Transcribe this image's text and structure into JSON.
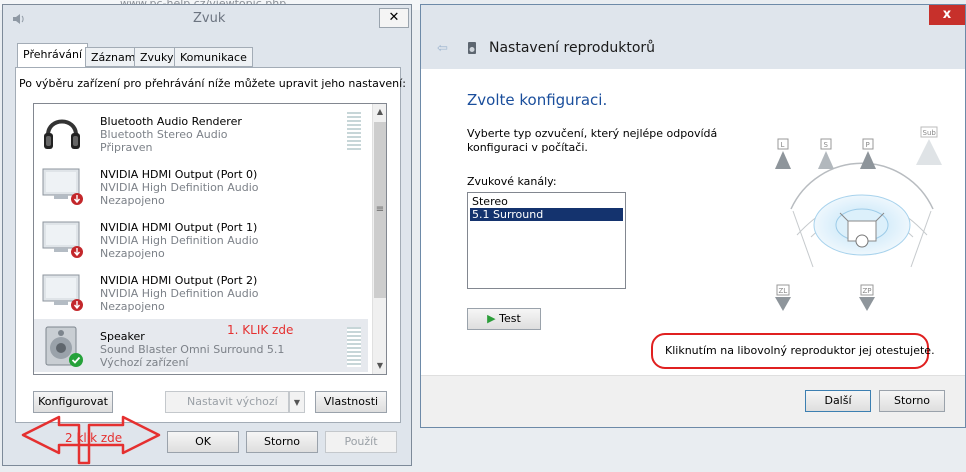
{
  "browser": {
    "url_text": "www.pc-help.cz/viewtopic.php"
  },
  "sound_dialog": {
    "title": "Zvuk",
    "close_symbol": "✕",
    "tabs": [
      {
        "label": "Přehrávání",
        "active": true
      },
      {
        "label": "Záznam",
        "active": false
      },
      {
        "label": "Zvuky",
        "active": false
      },
      {
        "label": "Komunikace",
        "active": false
      }
    ],
    "instruction": "Po výběru zařízení pro přehrávání níže můžete upravit jeho nastavení:",
    "devices": [
      {
        "name": "Bluetooth Audio Renderer",
        "driver": "Bluetooth Stereo Audio",
        "status": "Připraven",
        "icon": "headphones-icon",
        "selected": false
      },
      {
        "name": "NVIDIA HDMI Output (Port 0)",
        "driver": "NVIDIA High Definition Audio",
        "status": "Nezapojeno",
        "icon": "monitor-icon",
        "selected": false
      },
      {
        "name": "NVIDIA HDMI Output (Port 1)",
        "driver": "NVIDIA High Definition Audio",
        "status": "Nezapojeno",
        "icon": "monitor-icon",
        "selected": false
      },
      {
        "name": "NVIDIA HDMI Output (Port 2)",
        "driver": "NVIDIA High Definition Audio",
        "status": "Nezapojeno",
        "icon": "monitor-icon",
        "selected": false
      },
      {
        "name": "Speaker",
        "driver": "Sound Blaster Omni Surround 5.1",
        "status": "Výchozí zařízení",
        "icon": "speaker-icon",
        "selected": true
      }
    ],
    "buttons": {
      "configure": "Konfigurovat",
      "set_default": "Nastavit výchozí",
      "properties": "Vlastnosti",
      "ok": "OK",
      "cancel": "Storno",
      "apply": "Použít"
    },
    "annotations": {
      "step1": "1. KLIK zde",
      "step2": "2 klik zde",
      "color": "#e53030"
    }
  },
  "speaker_dialog": {
    "title": "Nastavení reproduktorů",
    "close_symbol": "x",
    "heading": "Zvolte konfiguraci.",
    "description": "Vyberte typ ozvučení, který nejlépe odpovídá konfiguraci v počítači.",
    "channels_label": "Zvukové kanály:",
    "channels": [
      {
        "label": "Stereo",
        "selected": false
      },
      {
        "label": "5.1 Surround",
        "selected": true
      }
    ],
    "test_button": "Test",
    "hint": "Kliknutím na libovolný reproduktor jej otestujete.",
    "speaker_labels": {
      "left": "L",
      "center": "S",
      "right": "P",
      "sub": "Sub",
      "rear_left": "ZL",
      "rear_right": "ZP"
    },
    "next_button": "Další",
    "cancel_button": "Storno",
    "colors": {
      "heading": "#1a4e9c",
      "selection": "#14336e",
      "close": "#c7302b",
      "highlight": "#e02020"
    }
  }
}
